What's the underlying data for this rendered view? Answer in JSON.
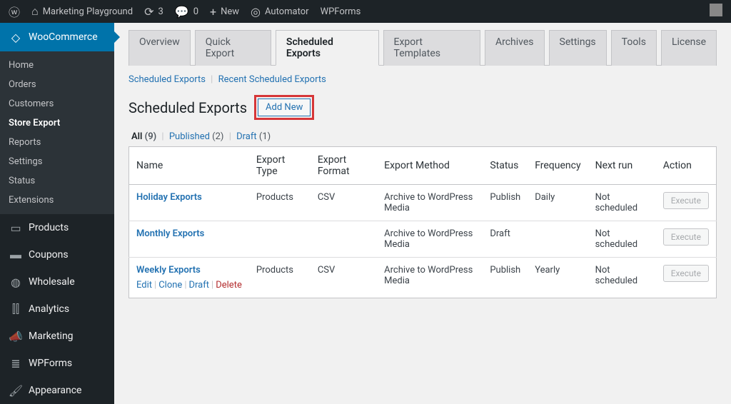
{
  "admin_bar": {
    "site_title": "Marketing Playground",
    "updates": "3",
    "comments": "0",
    "new": "New",
    "automator": "Automator",
    "wpforms": "WPForms"
  },
  "sidebar": {
    "woo": "WooCommerce",
    "sub": [
      "Home",
      "Orders",
      "Customers",
      "Store Export",
      "Reports",
      "Settings",
      "Status",
      "Extensions"
    ],
    "sub_current": "Store Export",
    "menu": [
      "Products",
      "Coupons",
      "Wholesale",
      "Analytics",
      "Marketing",
      "WPForms",
      "Appearance"
    ]
  },
  "tabs": [
    "Overview",
    "Quick Export",
    "Scheduled Exports",
    "Export Templates",
    "Archives",
    "Settings",
    "Tools",
    "License"
  ],
  "active_tab": "Scheduled Exports",
  "sub_links": {
    "a": "Scheduled Exports",
    "b": "Recent Scheduled Exports"
  },
  "page_title": "Scheduled Exports",
  "add_new": "Add New",
  "filters": {
    "all": {
      "label": "All",
      "count": "(9)"
    },
    "published": {
      "label": "Published",
      "count": "(2)"
    },
    "draft": {
      "label": "Draft",
      "count": "(1)"
    }
  },
  "columns": [
    "Name",
    "Export Type",
    "Export Format",
    "Export Method",
    "Status",
    "Frequency",
    "Next run",
    "Action"
  ],
  "rows": [
    {
      "name": "Holiday Exports",
      "type": "Products",
      "format": "CSV",
      "method": "Archive to WordPress Media",
      "status": "Publish",
      "freq": "Daily",
      "next": "Not scheduled",
      "action": "Execute",
      "show_row_actions": false
    },
    {
      "name": "Monthly Exports",
      "type": "",
      "format": "",
      "method": "Archive to WordPress Media",
      "status": "Draft",
      "freq": "",
      "next": "Not scheduled",
      "action": "Execute",
      "show_row_actions": false
    },
    {
      "name": "Weekly Exports",
      "type": "Products",
      "format": "CSV",
      "method": "Archive to WordPress Media",
      "status": "Publish",
      "freq": "Yearly",
      "next": "Not scheduled",
      "action": "Execute",
      "show_row_actions": true
    }
  ],
  "row_actions": {
    "edit": "Edit",
    "clone": "Clone",
    "draft": "Draft",
    "delete": "Delete"
  }
}
